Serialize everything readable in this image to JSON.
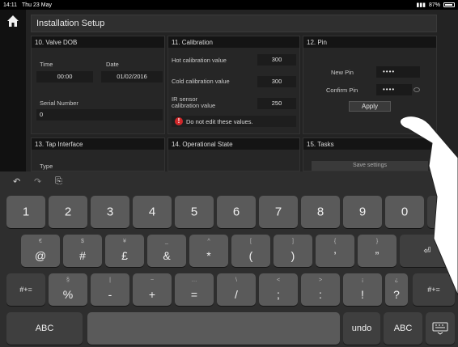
{
  "status_bar": {
    "time": "14:11",
    "date": "Thu 23 May",
    "battery": "87%"
  },
  "header": {
    "title": "Installation Setup"
  },
  "panels": {
    "valve_dob": {
      "title": "10. Valve DOB",
      "time_label": "Time",
      "time_value": "00:00",
      "date_label": "Date",
      "date_value": "01/02/2016",
      "serial_label": "Serial Number",
      "serial_value": "0"
    },
    "calibration": {
      "title": "11. Calibration",
      "hot_label": "Hot calibration value",
      "hot_value": "300",
      "cold_label": "Cold calibration value",
      "cold_value": "300",
      "ir_label_1": "IR sensor",
      "ir_label_2": "calibration value",
      "ir_value": "250",
      "warning": "Do not edit these values."
    },
    "pin": {
      "title": "12. Pin",
      "new_pin_label": "New Pin",
      "new_pin_value": "••••",
      "confirm_pin_label": "Confirm Pin",
      "confirm_pin_value": "••••",
      "apply_label": "Apply"
    },
    "tap_interface": {
      "title": "13. Tap Interface",
      "type_label": "Type"
    },
    "operational_state": {
      "title": "14. Operational State"
    },
    "tasks": {
      "title": "15. Tasks",
      "save_label": "Save settings"
    }
  },
  "keyboard": {
    "undo_symbol": "↶",
    "redo_symbol": "↷",
    "paste_symbol": "⎘",
    "number_row": [
      "1",
      "2",
      "3",
      "4",
      "5",
      "6",
      "7",
      "8",
      "9",
      "0"
    ],
    "symbol_row_main": [
      "@",
      "#",
      "£",
      "&",
      "*",
      "(",
      ")",
      "’",
      "”"
    ],
    "symbol_row_sub": [
      "€",
      "$",
      "¥",
      "_",
      "^",
      "[",
      "]",
      "{",
      "}"
    ],
    "third_row_main": [
      "%",
      "-",
      "+",
      "=",
      "/",
      ";",
      ":",
      "!",
      "?"
    ],
    "third_row_sub": [
      "§",
      "|",
      "~",
      "…",
      "\\",
      "<",
      ">",
      "¡",
      "¿"
    ],
    "return_symbol": "⏎",
    "more_label": "#+=",
    "abc_label": "ABC",
    "undo_label": "undo",
    "dismiss_icon": "keyboard-dismiss-icon"
  }
}
